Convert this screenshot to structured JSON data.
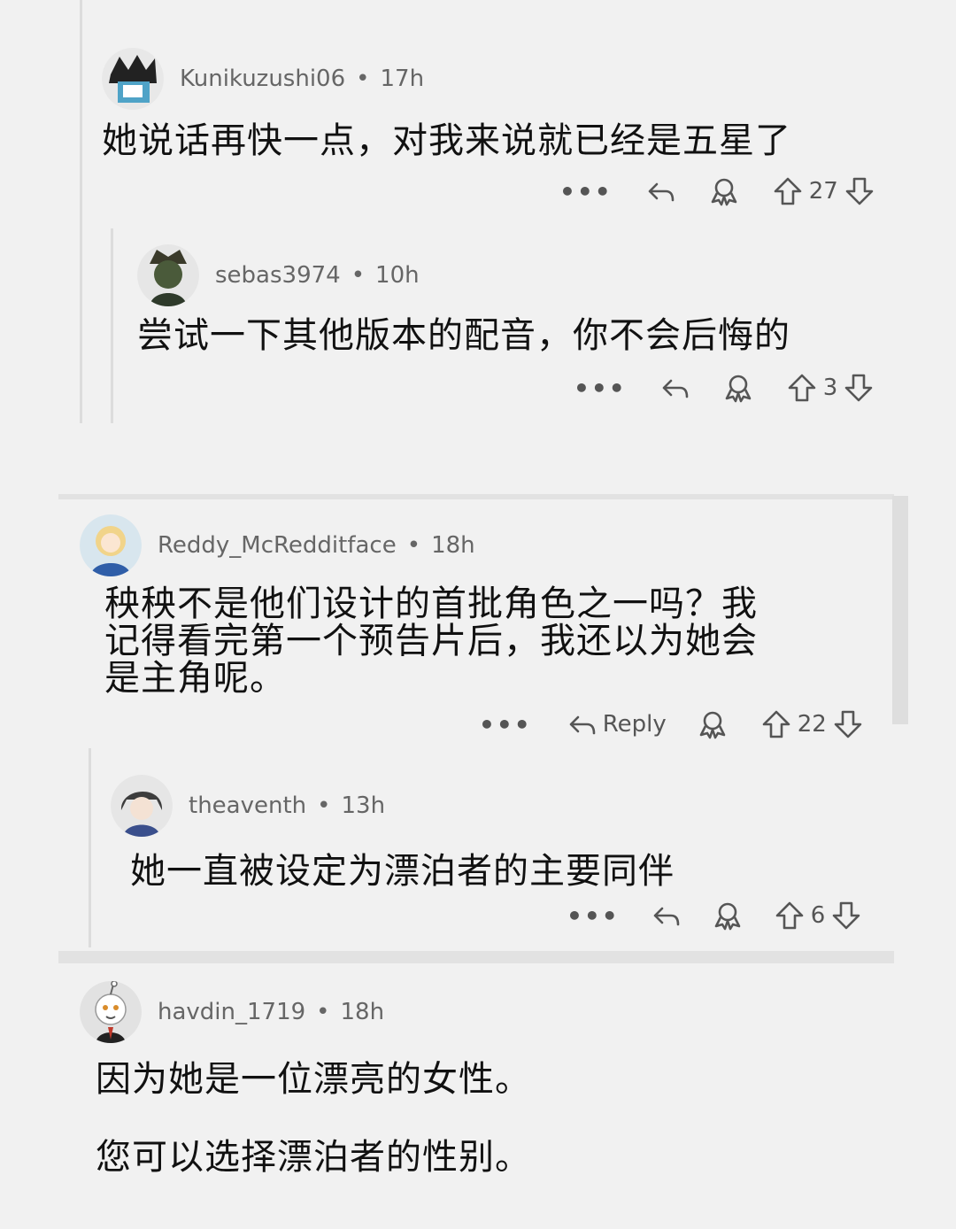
{
  "comments": [
    {
      "user": "Kunikuzushi06",
      "time": "17h",
      "text": "她说话再快一点，对我来说就已经是五星了",
      "votes": "27",
      "more": "•••"
    },
    {
      "user": "sebas3974",
      "time": "10h",
      "text": "尝试一下其他版本的配音，你不会后悔的",
      "votes": "3",
      "more": "•••"
    },
    {
      "user": "Reddy_McRedditface",
      "time": "18h",
      "text_lines": [
        "秧秧不是他们设计的首批角色之一吗？我",
        "记得看完第一个预告片后，我还以为她会",
        "是主角呢。"
      ],
      "reply_label": "Reply",
      "votes": "22",
      "more": "•••"
    },
    {
      "user": "theaventh",
      "time": "13h",
      "text": "她一直被设定为漂泊者的主要同伴",
      "votes": "6",
      "more": "•••"
    },
    {
      "user": "havdin_1719",
      "time": "18h",
      "text_lines": [
        "因为她是一位漂亮的女性。",
        "您可以选择漂泊者的性别。"
      ]
    }
  ],
  "separator": "•",
  "icons": {
    "reply": "reply-arrow-icon",
    "award": "award-icon",
    "upvote": "upvote-arrow-icon",
    "downvote": "downvote-arrow-icon",
    "more": "more-dots-icon"
  }
}
